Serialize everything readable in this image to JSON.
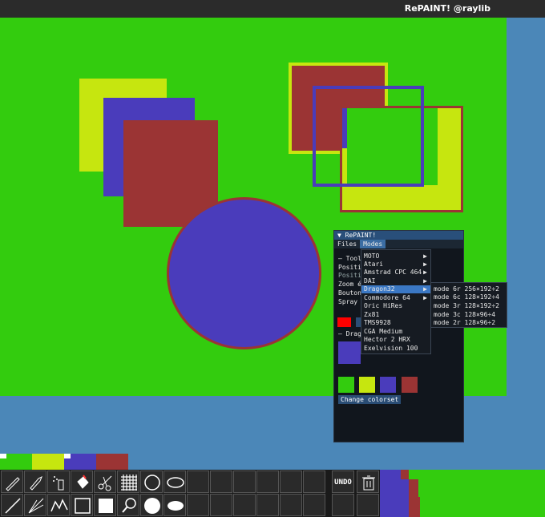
{
  "window": {
    "title": "RePAINT! @raylib"
  },
  "colors": {
    "green": "#33cc0e",
    "yellow": "#c6e60f",
    "blue": "#4a3cbb",
    "red": "#9b3434",
    "bg_blue": "#4b87b8"
  },
  "panel": {
    "title": "RePAINT!",
    "menus": [
      "Files",
      "Modes"
    ],
    "active_menu": "Modes",
    "partial_lines": [
      "— Tool",
      "Positio",
      "Positio",
      "Zoom é",
      "Bouton",
      "Spray s",
      "— Drag"
    ],
    "change_colorset_label": "Change colorset"
  },
  "modes_menu": {
    "items": [
      {
        "label": "MOTO",
        "submenu": true
      },
      {
        "label": "Atari",
        "submenu": true
      },
      {
        "label": "Amstrad CPC 464",
        "submenu": true
      },
      {
        "label": "DAI",
        "submenu": true
      },
      {
        "label": "Dragon32",
        "submenu": true,
        "selected": true
      },
      {
        "label": "Commodore 64",
        "submenu": true
      },
      {
        "label": "Oric HiRes",
        "submenu": false
      },
      {
        "label": "Zx81",
        "submenu": false
      },
      {
        "label": "TMS9928",
        "submenu": false
      },
      {
        "label": "CGA Medium",
        "submenu": false
      },
      {
        "label": "Hector 2 HRX",
        "submenu": false
      },
      {
        "label": "Exelvision 100",
        "submenu": false
      }
    ],
    "arrow_glyph": "▶"
  },
  "dragon32_submenu": [
    "mode 6r 256×192÷2",
    "mode 6c 128×192÷4",
    "mode 3r 128×192÷2",
    "mode 3c 128×96÷4",
    "mode 2r 128×96÷2"
  ],
  "toolbar": {
    "undo_label": "UNDO",
    "tools_row1": [
      "pencil-icon",
      "brush-icon",
      "spray-icon",
      "fill-bucket-icon",
      "scissors-icon",
      "grid-icon",
      "circle-outline-icon",
      "ellipse-outline-icon"
    ],
    "tools_row2": [
      "line-icon",
      "multiline-icon",
      "polyline-icon",
      "rectangle-outline-icon",
      "rectangle-filled-icon",
      "magnifier-icon",
      "circle-filled-icon",
      "ellipse-filled-icon"
    ]
  }
}
